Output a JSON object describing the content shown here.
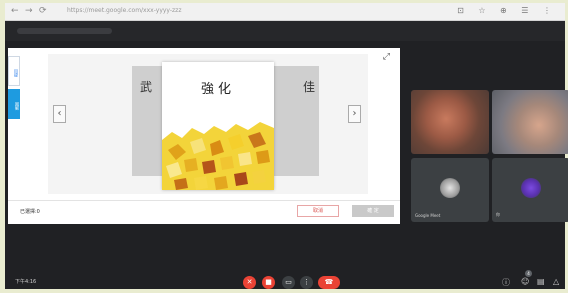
{
  "browser": {
    "url": "https://meet.google.com/xxx-yyyy-zzz",
    "nav_symbols": [
      "←",
      "→",
      "⟳"
    ],
    "right_icons": "⊡ ☆ ⊕ ☰ ⋮"
  },
  "book": {
    "title": "強化",
    "left_spine": "武",
    "right_spine": "佳"
  },
  "side_tabs": [
    "目録",
    "図解"
  ],
  "card": {
    "status": "已選擇:0",
    "button_a": "取消",
    "button_b": "確 定"
  },
  "participants": [
    {
      "name": ""
    },
    {
      "name": ""
    },
    {
      "name": "Google Meet"
    },
    {
      "name": "你"
    }
  ],
  "toolbar": {
    "left_text": "下午4:16",
    "badge_count": "4"
  },
  "colors": {
    "end_call": "#ea4335",
    "accent_blue": "#1e9be0"
  }
}
